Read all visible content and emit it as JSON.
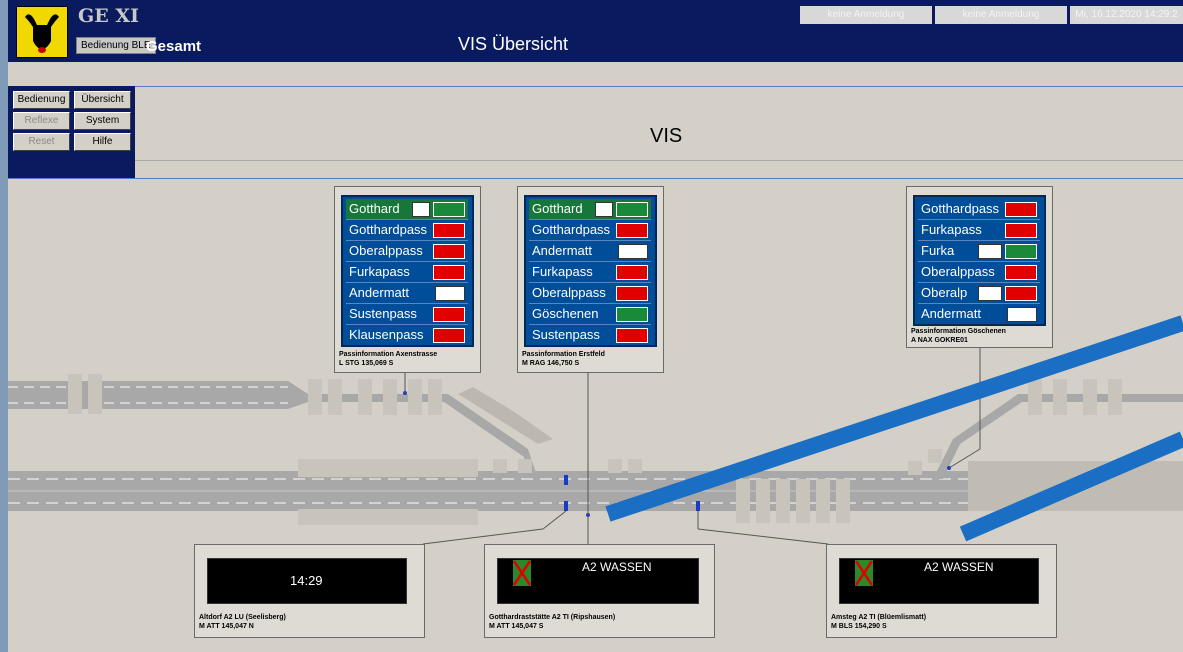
{
  "header": {
    "app_title": "GE XI",
    "mode_badge": "Bedienung BLE",
    "scope": "Gesamt",
    "page_heading": "VIS Übersicht",
    "status": [
      "keine Anmeldung",
      "keine Anmeldung",
      "Mi, 16.12.2020 14:29:2"
    ]
  },
  "menu": {
    "bedienung": "Bedienung",
    "uebersicht": "Übersicht",
    "reflexe": "Reflexe",
    "system": "System",
    "reset": "Reset",
    "hilfe": "Hilfe"
  },
  "vis_title": "VIS",
  "signs": [
    {
      "rows": [
        "Gotthard",
        "Gotthardpass",
        "Oberalppass",
        "Furkapass",
        "Andermatt",
        "Sustenpass",
        "Klausenpass"
      ],
      "caption": [
        "Passinformation Axenstrasse",
        "L STG 135,069 S"
      ]
    },
    {
      "rows": [
        "Gotthard",
        "Gotthardpass",
        "Andermatt",
        "Furkapass",
        "Oberalppass",
        "Göschenen",
        "Sustenpass"
      ],
      "caption": [
        "Passinformation Erstfeld",
        "M RAG 146,750 S"
      ]
    },
    {
      "rows": [
        "Gotthardpass",
        "Furkapass",
        "Furka",
        "Oberalppass",
        "Oberalp",
        "Andermatt"
      ],
      "caption": [
        "Passinformation Göschenen",
        "A NAX GOKRE01"
      ]
    }
  ],
  "vms": [
    {
      "text": "14:29",
      "caption": [
        "Altdorf A2 LU (Seelisberg)",
        "M ATT 145,047 N"
      ]
    },
    {
      "text": "A2 WASSEN",
      "caption": [
        "Gotthardraststätte A2 TI (Ripshausen)",
        "M ATT 145,047 S"
      ]
    },
    {
      "text": "A2 WASSEN",
      "caption": [
        "Amsteg A2 TI (Blüemlismatt)",
        "M BLS 154,290 S"
      ]
    }
  ],
  "colors": {
    "titlebar": "#0a1a5e",
    "sign_blue": "#004d99",
    "sign_green": "#17773a",
    "closed_red": "#e00000",
    "highlight_blue": "#1a6fc4"
  }
}
